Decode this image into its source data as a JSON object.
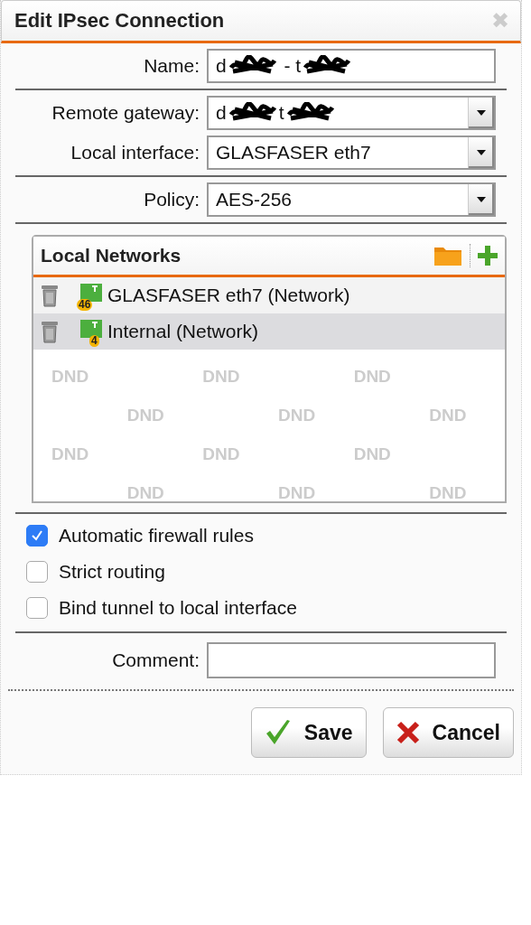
{
  "window": {
    "title": "Edit IPsec Connection",
    "close": "✖"
  },
  "sections": [
    {
      "fields": [
        {
          "kind": "text",
          "label": "Name:",
          "parts": [
            {
              "kind": "text",
              "text": "d"
            },
            {
              "kind": "scribble"
            },
            {
              "kind": "text",
              "text": " - t"
            },
            {
              "kind": "scribble"
            }
          ]
        }
      ]
    },
    {
      "fields": [
        {
          "kind": "select",
          "label": "Remote gateway:",
          "parts": [
            {
              "kind": "text",
              "text": "d"
            },
            {
              "kind": "scribble"
            },
            {
              "kind": "text",
              "text": "t"
            },
            {
              "kind": "scribble"
            }
          ]
        },
        {
          "kind": "select",
          "label": "Local interface:",
          "parts": [
            {
              "kind": "text",
              "text": "GLASFASER eth7"
            }
          ]
        }
      ]
    },
    {
      "fields": [
        {
          "kind": "select",
          "label": "Policy:",
          "parts": [
            {
              "kind": "text",
              "text": "AES-256"
            }
          ]
        }
      ]
    }
  ],
  "local_networks": {
    "title": "Local Networks",
    "items": [
      {
        "label": "GLASFASER eth7 (Network)",
        "badge": "46",
        "selected": false
      },
      {
        "label": "Internal (Network)",
        "badge": "4",
        "selected": true
      }
    ],
    "drop_marks": [
      "DND",
      "DND",
      "DND",
      "DND",
      "DND",
      "DND",
      "DND",
      "DND",
      "DND",
      "DND",
      "DND",
      "DND"
    ]
  },
  "options": [
    {
      "label": "Automatic firewall rules",
      "checked": true
    },
    {
      "label": "Strict routing",
      "checked": false
    },
    {
      "label": "Bind tunnel to local interface",
      "checked": false
    }
  ],
  "comment": {
    "label": "Comment:"
  },
  "buttons": [
    {
      "kind": "save",
      "label": "Save"
    },
    {
      "kind": "cancel",
      "label": "Cancel"
    }
  ]
}
